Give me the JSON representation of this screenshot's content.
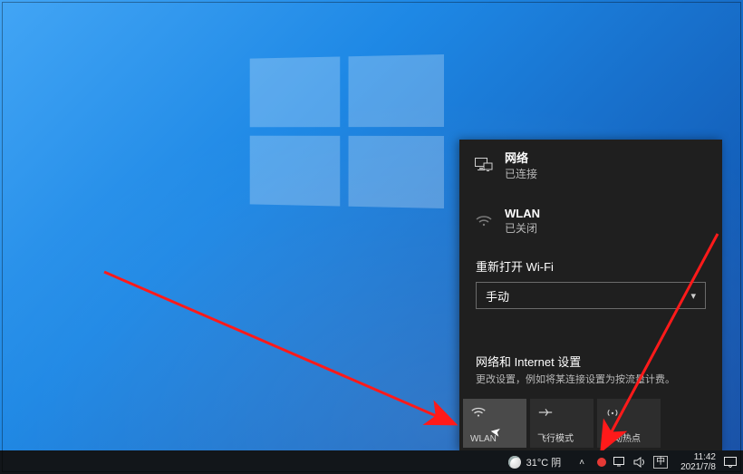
{
  "network_panel": {
    "ethernet": {
      "title": "网络",
      "status": "已连接"
    },
    "wlan": {
      "title": "WLAN",
      "status": "已关闭"
    },
    "reopen_label": "重新打开 Wi-Fi",
    "reopen_value": "手动",
    "settings_title": "网络和 Internet 设置",
    "settings_subtitle": "更改设置，例如将某连接设置为按流量计费。",
    "tiles": {
      "wlan": "WLAN",
      "airplane": "飞行模式",
      "hotspot": "移动热点"
    }
  },
  "taskbar": {
    "weather_text": "31°C 阴",
    "ime_text": "中",
    "time": "11:42",
    "date": "2021/7/8"
  },
  "icons": {
    "monitor": "monitor-icon",
    "wifi_off": "wifi-off-icon",
    "wifi": "wifi-icon",
    "airplane": "airplane-icon",
    "hotspot": "hotspot-icon",
    "chevdown": "chevron-down-icon",
    "chevup": "chevron-up-icon",
    "record": "record-icon",
    "speaker": "speaker-icon",
    "notif": "notification-icon"
  },
  "colors": {
    "arrow": "#ff1a1a"
  }
}
